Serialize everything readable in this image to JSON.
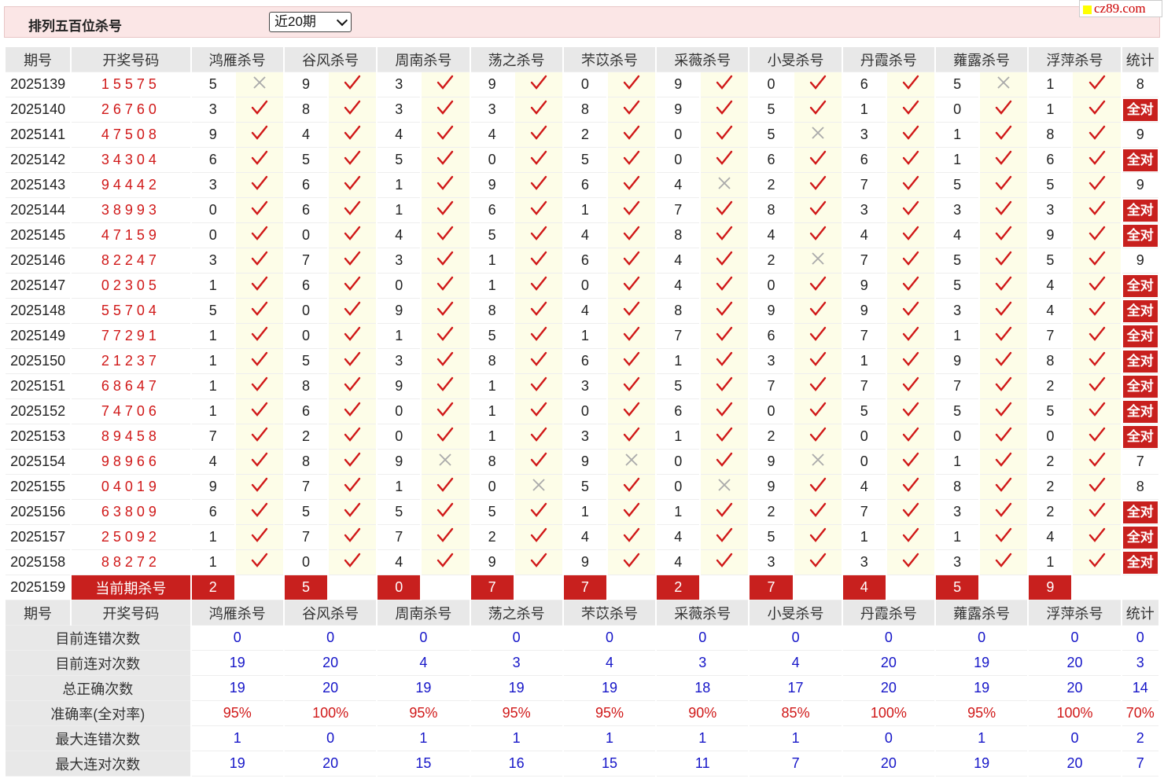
{
  "header": {
    "title": "排列五百位杀号",
    "period_select": "近20期",
    "site_badge": "cz89.com"
  },
  "columns": {
    "issue": "期号",
    "draw": "开奖号码",
    "experts": [
      "鸿雁杀号",
      "谷风杀号",
      "周南杀号",
      "荡之杀号",
      "芣苡杀号",
      "采薇杀号",
      "小旻杀号",
      "丹霞杀号",
      "蕹露杀号",
      "浮萍杀号"
    ],
    "stat": "统计"
  },
  "status_icons": {
    "hit": "check-icon",
    "miss": "cross-icon",
    "hit_color": "#d01818",
    "miss_color": "#aaaaaa"
  },
  "full_label": "全对",
  "rows": [
    {
      "issue": "2025139",
      "draw": "15575",
      "kills": [
        "5",
        "9",
        "3",
        "9",
        "0",
        "9",
        "0",
        "6",
        "5",
        "1"
      ],
      "hits": [
        0,
        1,
        1,
        1,
        1,
        1,
        1,
        1,
        0,
        1
      ],
      "stat": "8"
    },
    {
      "issue": "2025140",
      "draw": "26760",
      "kills": [
        "3",
        "8",
        "3",
        "3",
        "8",
        "9",
        "5",
        "1",
        "0",
        "1"
      ],
      "hits": [
        1,
        1,
        1,
        1,
        1,
        1,
        1,
        1,
        1,
        1
      ],
      "stat": "全对"
    },
    {
      "issue": "2025141",
      "draw": "47508",
      "kills": [
        "9",
        "4",
        "4",
        "4",
        "2",
        "0",
        "5",
        "3",
        "1",
        "8"
      ],
      "hits": [
        1,
        1,
        1,
        1,
        1,
        1,
        0,
        1,
        1,
        1
      ],
      "stat": "9"
    },
    {
      "issue": "2025142",
      "draw": "34304",
      "kills": [
        "6",
        "5",
        "5",
        "0",
        "5",
        "0",
        "6",
        "6",
        "1",
        "6"
      ],
      "hits": [
        1,
        1,
        1,
        1,
        1,
        1,
        1,
        1,
        1,
        1
      ],
      "stat": "全对"
    },
    {
      "issue": "2025143",
      "draw": "94442",
      "kills": [
        "3",
        "6",
        "1",
        "9",
        "6",
        "4",
        "2",
        "7",
        "5",
        "5"
      ],
      "hits": [
        1,
        1,
        1,
        1,
        1,
        0,
        1,
        1,
        1,
        1
      ],
      "stat": "9"
    },
    {
      "issue": "2025144",
      "draw": "38993",
      "kills": [
        "0",
        "6",
        "1",
        "6",
        "1",
        "7",
        "8",
        "3",
        "3",
        "3"
      ],
      "hits": [
        1,
        1,
        1,
        1,
        1,
        1,
        1,
        1,
        1,
        1
      ],
      "stat": "全对"
    },
    {
      "issue": "2025145",
      "draw": "47159",
      "kills": [
        "0",
        "0",
        "4",
        "5",
        "4",
        "8",
        "4",
        "4",
        "4",
        "9"
      ],
      "hits": [
        1,
        1,
        1,
        1,
        1,
        1,
        1,
        1,
        1,
        1
      ],
      "stat": "全对"
    },
    {
      "issue": "2025146",
      "draw": "82247",
      "kills": [
        "3",
        "7",
        "3",
        "1",
        "6",
        "4",
        "2",
        "7",
        "5",
        "5"
      ],
      "hits": [
        1,
        1,
        1,
        1,
        1,
        1,
        0,
        1,
        1,
        1
      ],
      "stat": "9"
    },
    {
      "issue": "2025147",
      "draw": "02305",
      "kills": [
        "1",
        "6",
        "0",
        "1",
        "0",
        "4",
        "0",
        "9",
        "5",
        "4"
      ],
      "hits": [
        1,
        1,
        1,
        1,
        1,
        1,
        1,
        1,
        1,
        1
      ],
      "stat": "全对"
    },
    {
      "issue": "2025148",
      "draw": "55704",
      "kills": [
        "5",
        "0",
        "9",
        "8",
        "4",
        "8",
        "9",
        "9",
        "3",
        "4"
      ],
      "hits": [
        1,
        1,
        1,
        1,
        1,
        1,
        1,
        1,
        1,
        1
      ],
      "stat": "全对"
    },
    {
      "issue": "2025149",
      "draw": "77291",
      "kills": [
        "1",
        "0",
        "1",
        "5",
        "1",
        "7",
        "6",
        "7",
        "1",
        "7"
      ],
      "hits": [
        1,
        1,
        1,
        1,
        1,
        1,
        1,
        1,
        1,
        1
      ],
      "stat": "全对"
    },
    {
      "issue": "2025150",
      "draw": "21237",
      "kills": [
        "1",
        "5",
        "3",
        "8",
        "6",
        "1",
        "3",
        "1",
        "9",
        "8"
      ],
      "hits": [
        1,
        1,
        1,
        1,
        1,
        1,
        1,
        1,
        1,
        1
      ],
      "stat": "全对"
    },
    {
      "issue": "2025151",
      "draw": "68647",
      "kills": [
        "1",
        "8",
        "9",
        "1",
        "3",
        "5",
        "7",
        "7",
        "7",
        "2"
      ],
      "hits": [
        1,
        1,
        1,
        1,
        1,
        1,
        1,
        1,
        1,
        1
      ],
      "stat": "全对"
    },
    {
      "issue": "2025152",
      "draw": "74706",
      "kills": [
        "1",
        "6",
        "0",
        "1",
        "0",
        "6",
        "0",
        "5",
        "5",
        "5"
      ],
      "hits": [
        1,
        1,
        1,
        1,
        1,
        1,
        1,
        1,
        1,
        1
      ],
      "stat": "全对"
    },
    {
      "issue": "2025153",
      "draw": "89458",
      "kills": [
        "7",
        "2",
        "0",
        "1",
        "3",
        "1",
        "2",
        "0",
        "0",
        "0"
      ],
      "hits": [
        1,
        1,
        1,
        1,
        1,
        1,
        1,
        1,
        1,
        1
      ],
      "stat": "全对"
    },
    {
      "issue": "2025154",
      "draw": "98966",
      "kills": [
        "4",
        "8",
        "9",
        "8",
        "9",
        "0",
        "9",
        "0",
        "1",
        "2"
      ],
      "hits": [
        1,
        1,
        0,
        1,
        0,
        1,
        0,
        1,
        1,
        1
      ],
      "stat": "7"
    },
    {
      "issue": "2025155",
      "draw": "04019",
      "kills": [
        "9",
        "7",
        "1",
        "0",
        "5",
        "0",
        "9",
        "4",
        "8",
        "2"
      ],
      "hits": [
        1,
        1,
        1,
        0,
        1,
        0,
        1,
        1,
        1,
        1
      ],
      "stat": "8"
    },
    {
      "issue": "2025156",
      "draw": "63809",
      "kills": [
        "6",
        "5",
        "5",
        "5",
        "1",
        "1",
        "2",
        "7",
        "3",
        "2"
      ],
      "hits": [
        1,
        1,
        1,
        1,
        1,
        1,
        1,
        1,
        1,
        1
      ],
      "stat": "全对"
    },
    {
      "issue": "2025157",
      "draw": "25092",
      "kills": [
        "1",
        "7",
        "7",
        "2",
        "4",
        "4",
        "5",
        "1",
        "1",
        "4"
      ],
      "hits": [
        1,
        1,
        1,
        1,
        1,
        1,
        1,
        1,
        1,
        1
      ],
      "stat": "全对"
    },
    {
      "issue": "2025158",
      "draw": "88272",
      "kills": [
        "1",
        "0",
        "4",
        "9",
        "9",
        "4",
        "3",
        "3",
        "3",
        "1"
      ],
      "hits": [
        1,
        1,
        1,
        1,
        1,
        1,
        1,
        1,
        1,
        1
      ],
      "stat": "全对"
    }
  ],
  "current": {
    "issue": "2025159",
    "label": "当前期杀号",
    "kills": [
      "2",
      "5",
      "0",
      "7",
      "7",
      "2",
      "7",
      "4",
      "5",
      "9"
    ]
  },
  "summary": [
    {
      "label": "目前连错次数",
      "values": [
        "0",
        "0",
        "0",
        "0",
        "0",
        "0",
        "0",
        "0",
        "0",
        "0"
      ],
      "stat": "0",
      "pct": false
    },
    {
      "label": "目前连对次数",
      "values": [
        "19",
        "20",
        "4",
        "3",
        "4",
        "3",
        "4",
        "20",
        "19",
        "20"
      ],
      "stat": "3",
      "pct": false
    },
    {
      "label": "总正确次数",
      "values": [
        "19",
        "20",
        "19",
        "19",
        "19",
        "18",
        "17",
        "20",
        "19",
        "20"
      ],
      "stat": "14",
      "pct": false
    },
    {
      "label": "准确率(全对率)",
      "values": [
        "95%",
        "100%",
        "95%",
        "95%",
        "95%",
        "90%",
        "85%",
        "100%",
        "95%",
        "100%"
      ],
      "stat": "70%",
      "pct": true
    },
    {
      "label": "最大连错次数",
      "values": [
        "1",
        "0",
        "1",
        "1",
        "1",
        "1",
        "1",
        "0",
        "1",
        "0"
      ],
      "stat": "2",
      "pct": false
    },
    {
      "label": "最大连对次数",
      "values": [
        "19",
        "20",
        "15",
        "16",
        "15",
        "11",
        "7",
        "20",
        "19",
        "20"
      ],
      "stat": "7",
      "pct": false
    }
  ]
}
